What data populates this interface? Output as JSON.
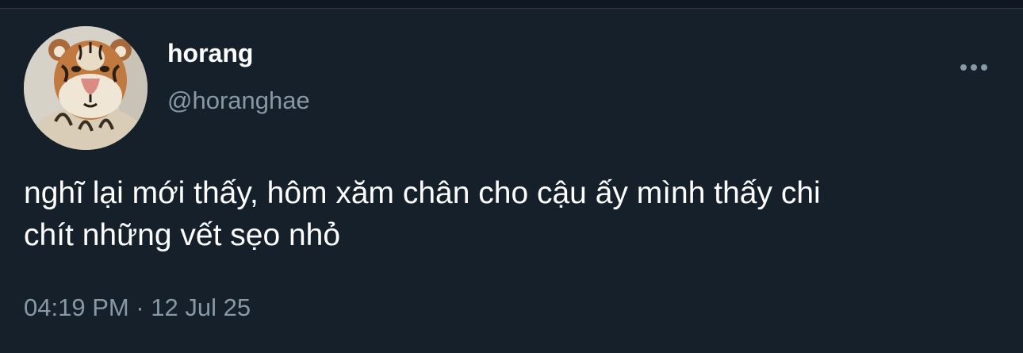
{
  "tweet": {
    "author": {
      "display_name": "horang",
      "handle": "@horanghae",
      "avatar_icon": "tiger-avatar"
    },
    "more_icon": "more-options-icon",
    "text_line_1": "nghĩ lại mới thấy, hôm xăm chân cho cậu ấy mình thấy chi",
    "text_line_2": "chít những vết sẹo nhỏ",
    "time": "04:19 PM",
    "separator": "·",
    "date": "12 Jul 25"
  },
  "colors": {
    "background": "#15202b",
    "primary_text": "#ffffff",
    "secondary_text": "#8899a6"
  }
}
